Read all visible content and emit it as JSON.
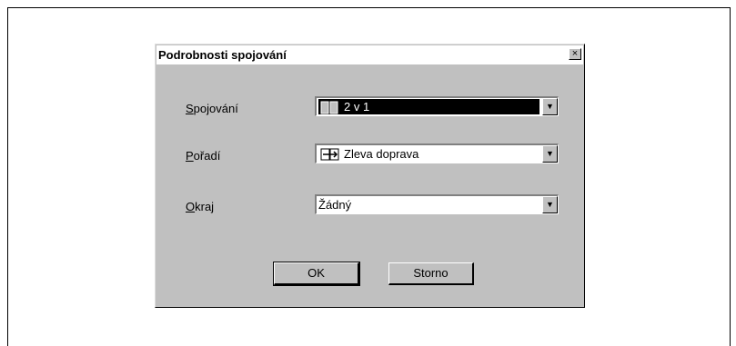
{
  "dialog": {
    "title": "Podrobnosti spojování",
    "close_label": "×"
  },
  "fields": [
    {
      "label": "Spojování",
      "value": "2 v 1",
      "icon": "two-pages-icon"
    },
    {
      "label": "Pořadí",
      "value": "Zleva doprava",
      "icon": "left-to-right-icon"
    },
    {
      "label": "Okraj",
      "value": "Žádný",
      "icon": ""
    }
  ],
  "buttons": {
    "ok": "OK",
    "cancel": "Storno"
  },
  "colors": {
    "face": "#c0c0c0",
    "selection": "#000000"
  }
}
